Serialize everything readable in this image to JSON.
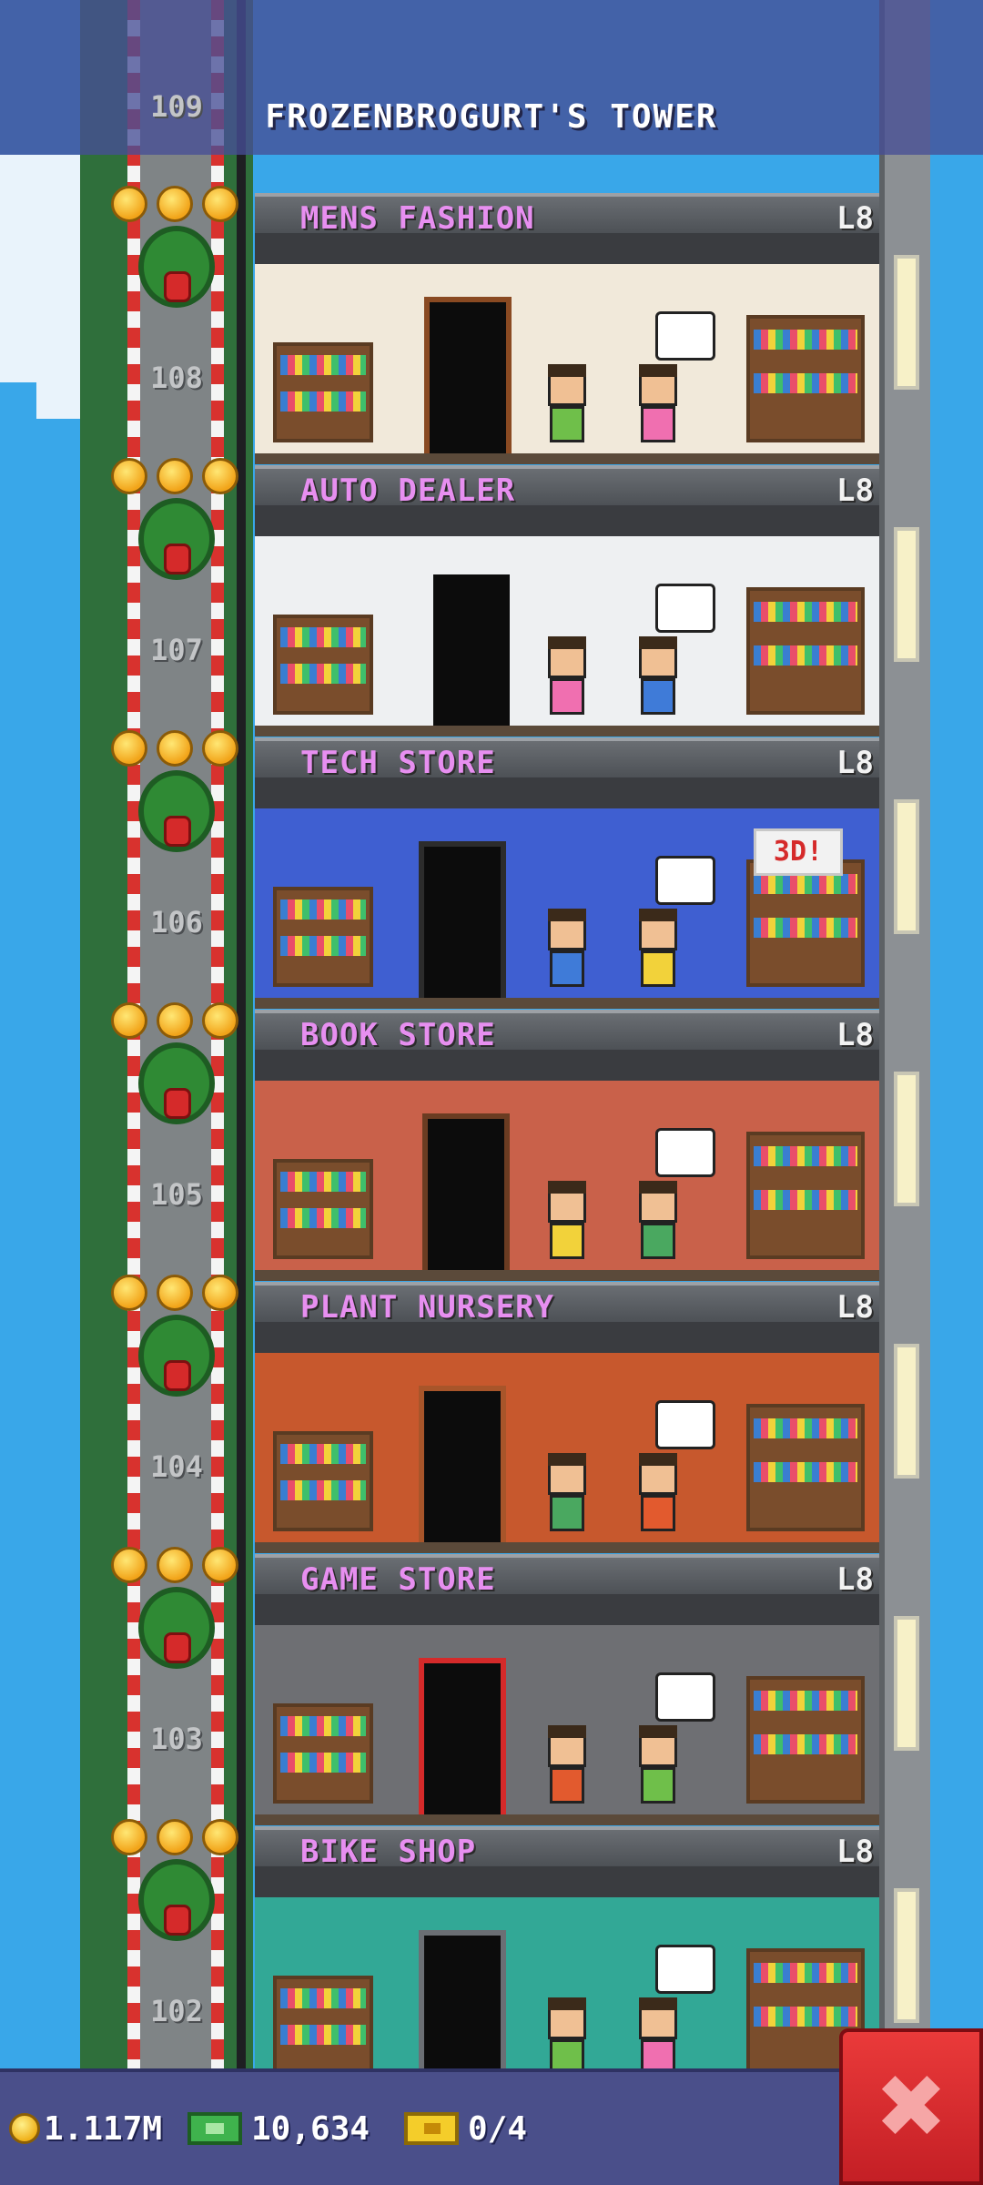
{
  "header": {
    "tower_title": "FROZENBROGURT'S TOWER"
  },
  "floors": [
    {
      "name": "MENS FASHION",
      "level_badge": "L8",
      "floor_number": "108",
      "theme_color": "#efe6d3",
      "wall_color": "#f1e9da"
    },
    {
      "name": "AUTO DEALER",
      "level_badge": "L8",
      "floor_number": "107",
      "theme_color": "#eef0f2",
      "wall_color": "#eef0f2"
    },
    {
      "name": "TECH STORE",
      "level_badge": "L8",
      "floor_number": "106",
      "theme_color": "#3f5fd1",
      "wall_color": "#3f5fd1"
    },
    {
      "name": "BOOK STORE",
      "level_badge": "L8",
      "floor_number": "105",
      "theme_color": "#c9614a",
      "wall_color": "#c9614a"
    },
    {
      "name": "PLANT NURSERY",
      "level_badge": "L8",
      "floor_number": "104",
      "theme_color": "#c7582d",
      "wall_color": "#c7582d"
    },
    {
      "name": "GAME STORE",
      "level_badge": "L8",
      "floor_number": "103",
      "theme_color": "#6e6f73",
      "wall_color": "#6e6f73"
    },
    {
      "name": "BIKE SHOP",
      "level_badge": "L8",
      "floor_number": "102",
      "theme_color": "#32a896",
      "wall_color": "#32a896"
    }
  ],
  "top_floor_number": "109",
  "tech_store_sign": "3D!",
  "status": {
    "coins": "1.117M",
    "bux": "10,634",
    "tickets": "0/4"
  },
  "icons": {
    "coins": "coin-icon",
    "bux": "tower-bux-icon",
    "tickets": "ticket-icon",
    "close": "close-icon"
  },
  "colors": {
    "floor_name": "#e78ff0",
    "top_bar": "#464e96",
    "bottom_bar": "#4a4f8a",
    "close_button": "#ea3a3a"
  }
}
